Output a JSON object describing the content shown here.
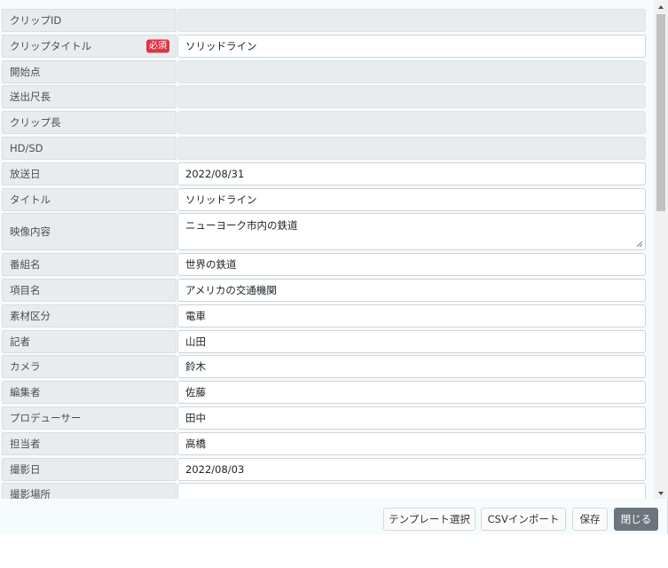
{
  "form": {
    "fields": [
      {
        "label": "クリップID",
        "value": "",
        "readonly": true
      },
      {
        "label": "クリップタイトル",
        "value": "ソリッドライン",
        "required_badge": "必須"
      },
      {
        "label": "開始点",
        "value": "",
        "readonly": true
      },
      {
        "label": "送出尺長",
        "value": "",
        "readonly": true
      },
      {
        "label": "クリップ長",
        "value": "",
        "readonly": true
      },
      {
        "label": "HD/SD",
        "value": "",
        "readonly": true
      },
      {
        "label": "放送日",
        "value": "2022/08/31"
      },
      {
        "label": "タイトル",
        "value": "ソリッドライン"
      },
      {
        "label": "映像内容",
        "value": "ニューヨーク市内の鉄道",
        "multiline": true
      },
      {
        "label": "番組名",
        "value": "世界の鉄道"
      },
      {
        "label": "項目名",
        "value": "アメリカの交通機関"
      },
      {
        "label": "素材区分",
        "value": "電車"
      },
      {
        "label": "記者",
        "value": "山田"
      },
      {
        "label": "カメラ",
        "value": "鈴木"
      },
      {
        "label": "編集者",
        "value": "佐藤"
      },
      {
        "label": "プロデューサー",
        "value": "田中"
      },
      {
        "label": "担当者",
        "value": "高橋"
      },
      {
        "label": "撮影日",
        "value": "2022/08/03"
      },
      {
        "label": "撮影場所",
        "value": ""
      }
    ]
  },
  "footer": {
    "template_label": "テンプレート選択",
    "csv_label": "CSVインポート",
    "save_label": "保存",
    "close_label": "閉じる"
  },
  "colors": {
    "label_bg": "#e9ecef",
    "required": "#dc3545",
    "close_button": "#6c757d",
    "dialog_bg": "#f6fcfe"
  }
}
